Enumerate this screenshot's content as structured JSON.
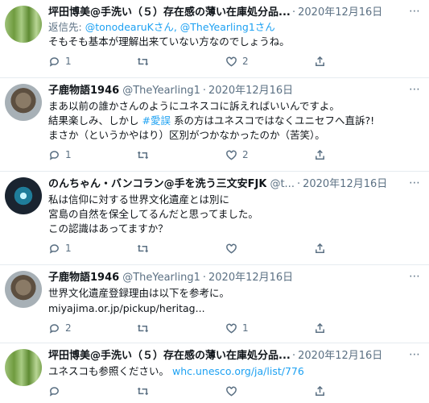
{
  "tweets": [
    {
      "name": "坪田博美@手洗い（５）存在感の薄い在庫処分品...",
      "handle": "",
      "date": "2020年12月16日",
      "reply_prefix": "返信先: ",
      "reply_users": "@tonodearuKさん, @TheYearling1さん",
      "text": "そもそも基本が理解出来ていない方なのでしょうね。",
      "counts": {
        "reply": "1",
        "retweet": "",
        "like": "2"
      }
    },
    {
      "name": "子鹿物語1946",
      "handle": "@TheYearling1",
      "date": "2020年12月16日",
      "text_a": "まあ以前の誰かさんのようにユネスコに訴えればいいんですよ。\n結果楽しみ、しかし ",
      "hashtag": "#愛誤",
      "text_b": " 系の方はユネスコではなくユニセフへ直訴?!\nまさか（というかやはり）区別がつかなかったのか（苦笑）。",
      "counts": {
        "reply": "1",
        "retweet": "",
        "like": "2"
      }
    },
    {
      "name": "のんちゃん・バンコラン@手を洗う三文安FJK",
      "handle": "@t...",
      "date": "2020年12月16日",
      "text": "私は信仰に対する世界文化遺産とは別に\n宮島の自然を保全してるんだと思ってました。\nこの認識はあってますか？",
      "counts": {
        "reply": "1",
        "retweet": "",
        "like": ""
      }
    },
    {
      "name": "子鹿物語1946",
      "handle": "@TheYearling1",
      "date": "2020年12月16日",
      "text": "世界文化遺産登録理由は以下を参考に。",
      "link": "miyajima.or.jp/pickup/heritag...",
      "counts": {
        "reply": "2",
        "retweet": "",
        "like": "1"
      }
    },
    {
      "name": "坪田博美@手洗い（５）存在感の薄い在庫処分品...",
      "handle": "",
      "date": "2020年12月16日",
      "text": "ユネスコも参照ください。",
      "link": "whc.unesco.org/ja/list/776",
      "counts": {
        "reply": "",
        "retweet": "",
        "like": ""
      }
    }
  ],
  "separator": "·",
  "more_glyph": "⋯"
}
